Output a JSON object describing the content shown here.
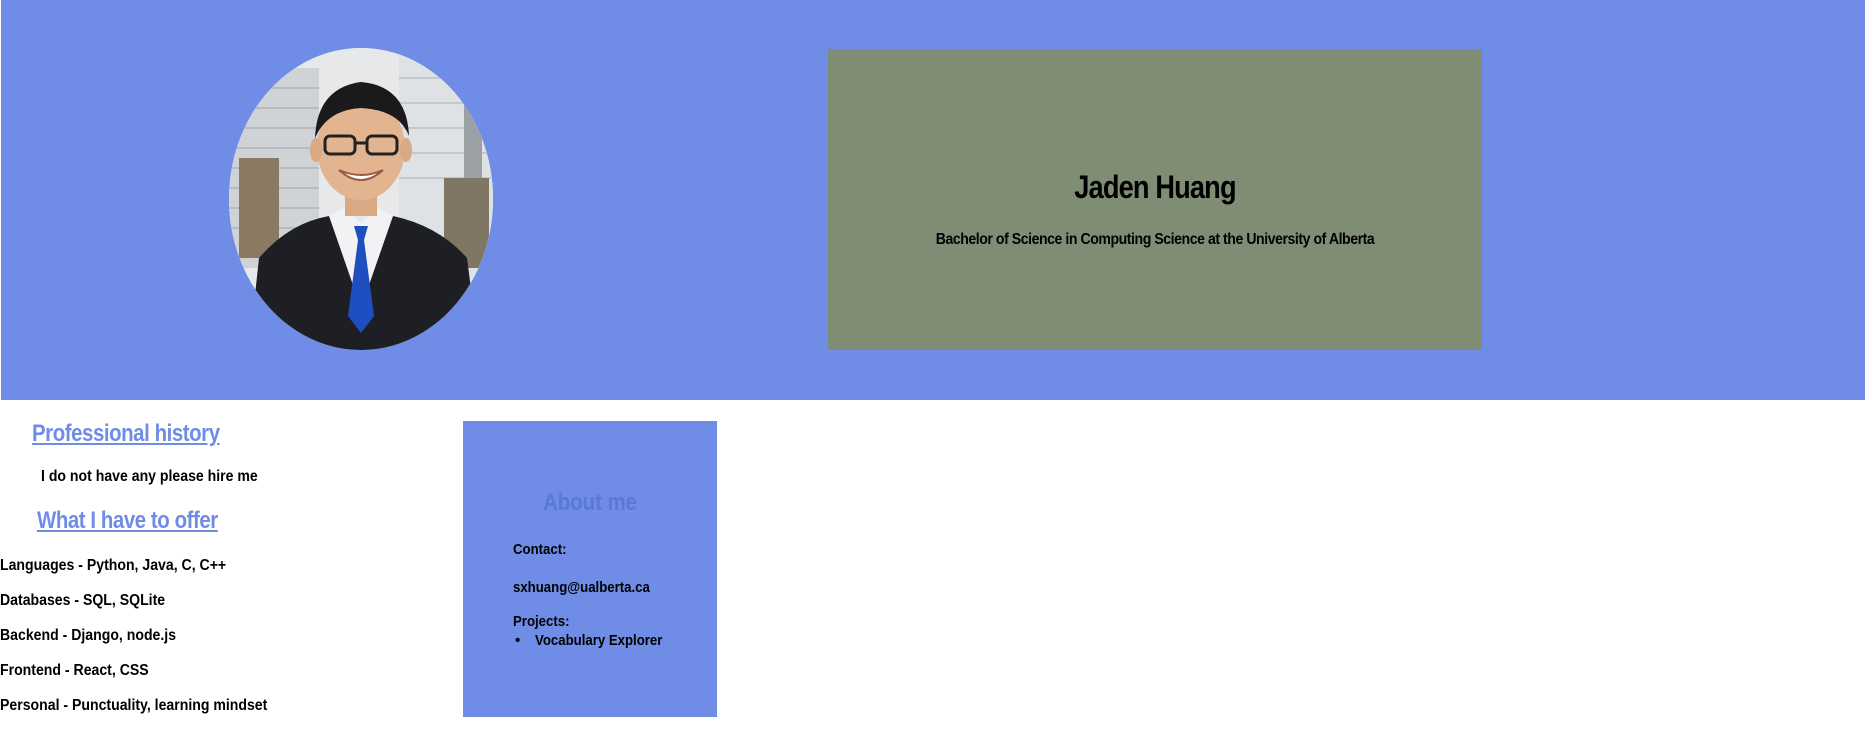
{
  "header": {
    "name": "Jaden Huang",
    "subtitle": "Bachelor of Science in Computing Science at the University of Alberta",
    "photo_icon": "profile-photo",
    "background_color": "#6f8ce6",
    "name_box_color": "#808d75"
  },
  "professional_history": {
    "heading": "Professional history",
    "text": "I do not have any please hire me"
  },
  "offer": {
    "heading": "What I have to offer",
    "skills": [
      {
        "key": "Languages",
        "sep": " - ",
        "value": "Python, Java, C, C++"
      },
      {
        "key": "Databases",
        "sep": " - ",
        "value": "SQL, SQLite"
      },
      {
        "key": "Backend",
        "sep": " - ",
        "value": "Django, node.js"
      },
      {
        "key": "Frontend",
        "sep": " - ",
        "value": "React, CSS"
      },
      {
        "key": "Personal",
        "sep": " - ",
        "value": "Punctuality, learning mindset"
      }
    ]
  },
  "about": {
    "heading": "About me",
    "contact_label": "Contact:",
    "email": "sxhuang@ualberta.ca",
    "projects_label": "Projects:",
    "projects": [
      "Vocabulary Explorer"
    ],
    "heading_color": "#5a78d6"
  }
}
